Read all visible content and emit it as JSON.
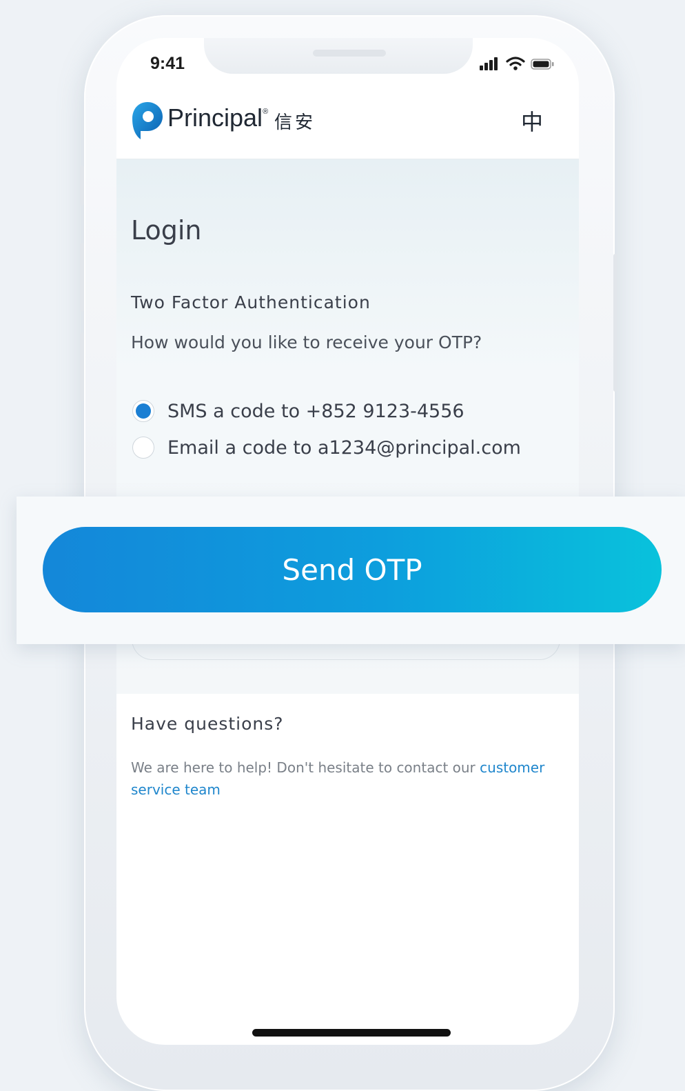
{
  "status_bar": {
    "time": "9:41",
    "icons": [
      "signal-icon",
      "wifi-icon",
      "battery-icon"
    ]
  },
  "header": {
    "logo_name": "Principal",
    "logo_registered": "®",
    "logo_cjk": "信安",
    "language_toggle": "中"
  },
  "page": {
    "title": "Login",
    "section_title": "Two Factor Authentication",
    "question": "How would you like to receive your OTP?"
  },
  "otp_options": [
    {
      "label": "SMS a code to +852 9123-4556",
      "selected": true
    },
    {
      "label": "Email a code to a1234@principal.com",
      "selected": false
    }
  ],
  "cta": {
    "label": "Send OTP"
  },
  "help": {
    "title": "Have questions?",
    "text": "We are here to help! Don't hesitate to contact our ",
    "link": "customer service team"
  },
  "colors": {
    "accent": "#1B7FD3",
    "cta_start": "#1487D9",
    "cta_end": "#09C2DC",
    "link": "#1F86CC"
  }
}
